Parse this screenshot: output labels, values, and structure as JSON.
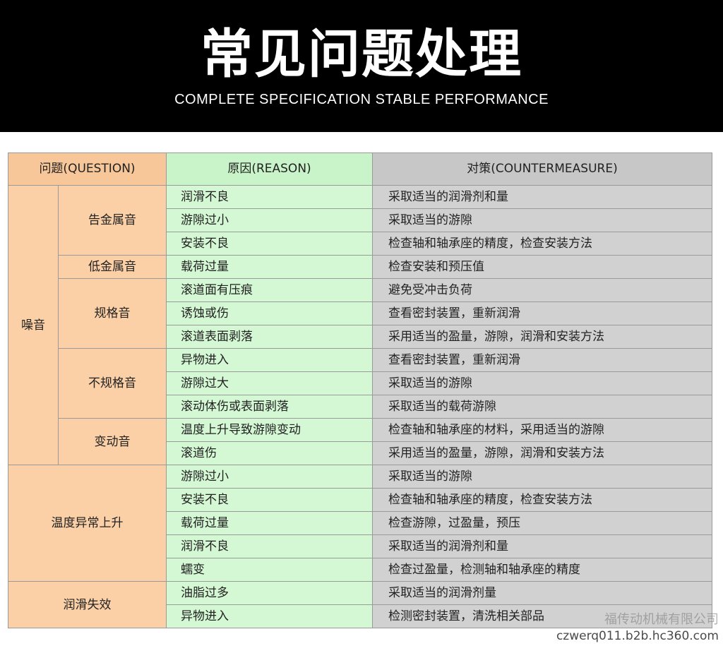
{
  "header": {
    "title": "常见问题处理",
    "subtitle": "COMPLETE SPECIFICATION STABLE PERFORMANCE"
  },
  "table": {
    "headers": {
      "question": "问题(QUESTION)",
      "reason": "原因(REASON)",
      "countermeasure": "对策(COUNTERMEASURE)"
    },
    "noise_label": "噪音",
    "temperature_label": "温度异常上升",
    "lubrication_label": "润滑失效",
    "noise_groups": [
      {
        "label": "告金属音",
        "rows": [
          {
            "reason": "润滑不良",
            "measure": "采取适当的润滑剂和量"
          },
          {
            "reason": "游隙过小",
            "measure": "采取适当的游隙"
          },
          {
            "reason": "安装不良",
            "measure": "检查轴和轴承座的精度，检查安装方法"
          }
        ]
      },
      {
        "label": "低金属音",
        "rows": [
          {
            "reason": "载荷过量",
            "measure": "检查安装和预压值"
          }
        ]
      },
      {
        "label": "规格音",
        "rows": [
          {
            "reason": "滚道面有压痕",
            "measure": "避免受冲击负荷"
          },
          {
            "reason": "诱蚀或伤",
            "measure": "查看密封装置，重新润滑"
          },
          {
            "reason": "滚道表面剥落",
            "measure": "采用适当的盈量，游隙，润滑和安装方法"
          }
        ]
      },
      {
        "label": "不规格音",
        "rows": [
          {
            "reason": "异物进入",
            "measure": "查看密封装置，重新润滑"
          },
          {
            "reason": "游隙过大",
            "measure": "采取适当的游隙"
          },
          {
            "reason": "滚动体伤或表面剥落",
            "measure": "采取适当的载荷游隙"
          }
        ]
      },
      {
        "label": "变动音",
        "rows": [
          {
            "reason": "温度上升导致游隙变动",
            "measure": "检查轴和轴承座的材料，采用适当的游隙"
          },
          {
            "reason": "滚道伤",
            "measure": "采用适当的盈量，游隙，润滑和安装方法"
          }
        ]
      }
    ],
    "temperature_rows": [
      {
        "reason": "游隙过小",
        "measure": "采取适当的游隙"
      },
      {
        "reason": "安装不良",
        "measure": "检查轴和轴承座的精度，检查安装方法"
      },
      {
        "reason": "载荷过量",
        "measure": "检查游隙，过盈量，预压"
      },
      {
        "reason": "润滑不良",
        "measure": "采取适当的润滑剂和量"
      },
      {
        "reason": "蠕变",
        "measure": "检查过盈量，检测轴和轴承座的精度"
      }
    ],
    "lubrication_rows": [
      {
        "reason": "油脂过多",
        "measure": "采取适当的润滑剂量"
      },
      {
        "reason": "异物进入",
        "measure": "检测密封装置，清洗相关部品"
      }
    ]
  },
  "watermark": "福传动机械有限公司",
  "site": "czwerq011.b2b.hc360.com"
}
